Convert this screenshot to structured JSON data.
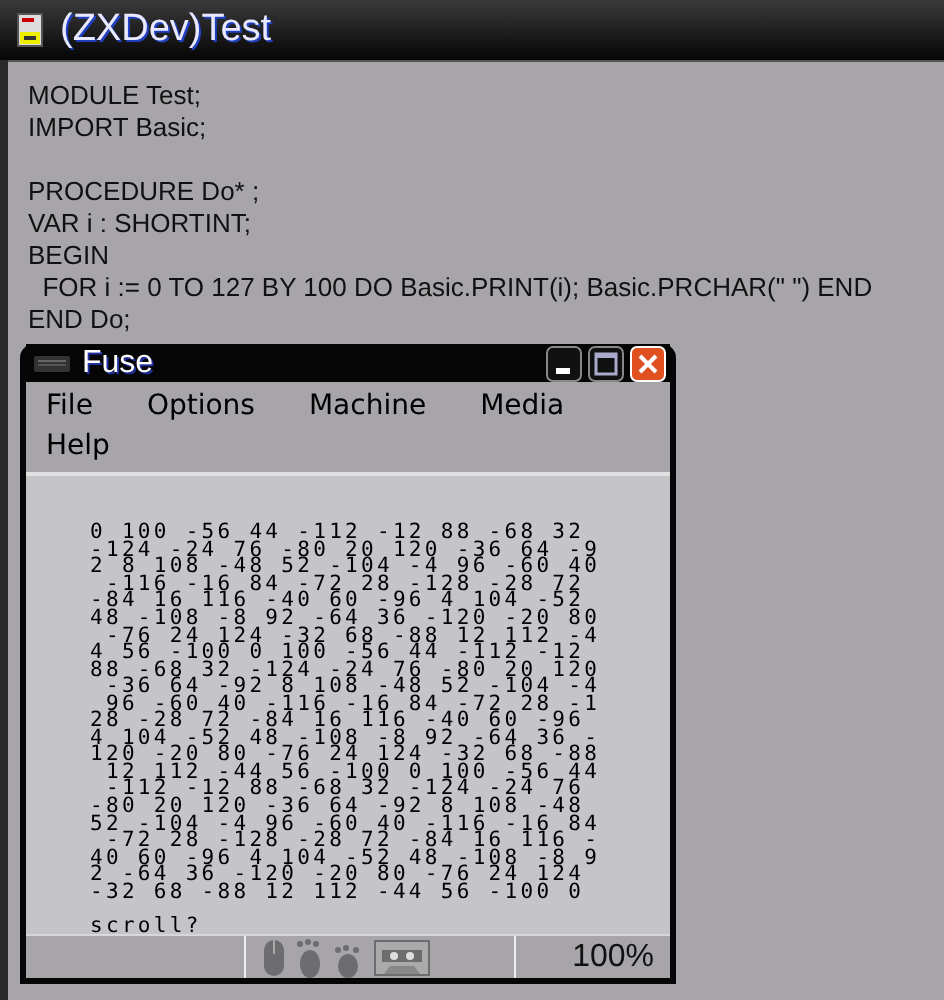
{
  "editor": {
    "title": "(ZXDev)Test",
    "code_blocks": [
      [
        "MODULE Test;",
        "IMPORT Basic;"
      ],
      [
        "PROCEDURE Do* ;",
        "VAR i : SHORTINT;",
        "BEGIN",
        "  FOR i := 0 TO 127 BY 100 DO Basic.PRINT(i); Basic.PRCHAR(\" \") END",
        "END Do;"
      ]
    ]
  },
  "fuse": {
    "title": "Fuse",
    "menu": [
      "File",
      "Options",
      "Machine",
      "Media",
      "Help"
    ],
    "screen_lines": [
      "0 100 -56 44 -112 -12 88 -68 32",
      "-124 -24 76 -80 20 120 -36 64 -9",
      "2 8 108 -48 52 -104 -4 96 -60 40",
      " -116 -16 84 -72 28 -128 -28 72",
      "-84 16 116 -40 60 -96 4 104 -52",
      "48 -108 -8 92 -64 36 -120 -20 80",
      " -76 24 124 -32 68 -88 12 112 -4",
      "4 56 -100 0 100 -56 44 -112 -12",
      "88 -68 32 -124 -24 76 -80 20 120",
      " -36 64 -92 8 108 -48 52 -104 -4",
      " 96 -60 40 -116 -16 84 -72 28 -1",
      "28 -28 72 -84 16 116 -40 60 -96",
      "4 104 -52 48 -108 -8 92 -64 36 -",
      "120 -20 80 -76 24 124 -32 68 -88",
      " 12 112 -44 56 -100 0 100 -56 44",
      " -112 -12 88 -68 32 -124 -24 76",
      "-80 20 120 -36 64 -92 8 108 -48",
      "52 -104 -4 96 -60 40 -116 -16 84",
      " -72 28 -128 -28 72 -84 16 116 -",
      "40 60 -96 4 104 -52 48 -108 -8 9",
      "2 -64 36 -120 -20 80 -76 24 124",
      "-32 68 -88 12 112 -44 56 -100 0"
    ],
    "prompt": "scroll?",
    "zoom": "100%"
  }
}
